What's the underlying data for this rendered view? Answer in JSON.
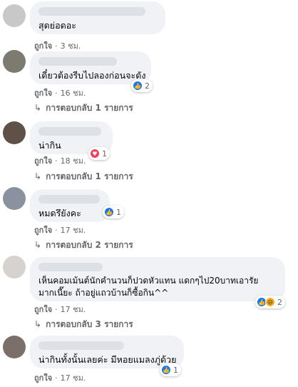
{
  "like_label": "ถูกใจ",
  "comments": [
    {
      "text": "สุดย่อดอะ",
      "time": "3 ชม."
    },
    {
      "text": "เดี๋ยวต้องรีบไปลองก่อนจะดัง",
      "time": "16 ชม.",
      "reaction_count": "2",
      "replies": "การตอบกลับ 1 รายการ"
    },
    {
      "text": "น่ากิน",
      "time": "18 ชม.",
      "reaction_count": "1",
      "replies": "การตอบกลับ 1 รายการ"
    },
    {
      "text": "หมดรึยังคะ",
      "time": "17 ชม.",
      "reaction_count": "1",
      "replies": "การตอบกลับ 2 รายการ"
    },
    {
      "text_line1": "เห็นคอมเม้นต์นักคำนวนก็ปวดหัวแทน แดกๆไป20บาทเอารัย",
      "text_line2": "มากเนี๊ยะ ถ้าอยู่แถวบ้านก็ซื้อกิน^^",
      "time": "17 ชม.",
      "reaction_count": "2",
      "replies": "การตอบกลับ 3 รายการ"
    },
    {
      "text": "น่ากินทั้งนั้นเลยค่ะ มีหอยแมลงภู่ด้วย",
      "time": "17 ชม.",
      "reaction_count": "1"
    }
  ],
  "colors": {
    "bubble": "#f0f2f5",
    "meta": "#65676b",
    "like_blue": "#1877f2",
    "love_red": "#f33e58",
    "haha_yellow": "#f7b125"
  },
  "icons": {
    "like": "thumbs-up-icon",
    "love": "heart-icon",
    "haha": "laughing-face-icon",
    "reply": "reply-arrow-icon"
  }
}
